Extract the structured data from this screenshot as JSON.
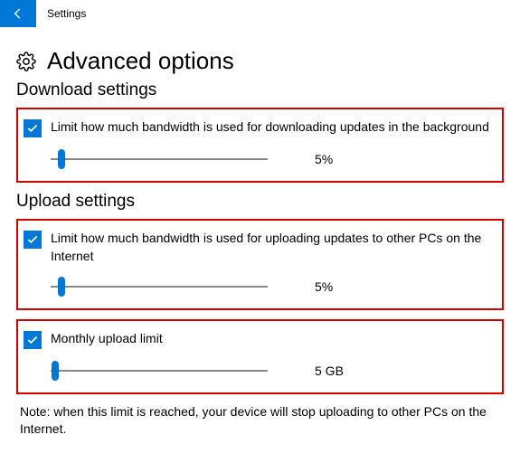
{
  "titlebar": {
    "app_title": "Settings"
  },
  "page": {
    "title": "Advanced options"
  },
  "download": {
    "heading": "Download settings",
    "limit_checkbox_label": "Limit how much bandwidth is used for downloading updates in the background",
    "limit_checked": true,
    "limit_value_label": "5%",
    "limit_slider_percent": 5
  },
  "upload": {
    "heading": "Upload settings",
    "limit_checkbox_label": "Limit how much bandwidth is used for uploading updates to other PCs on the Internet",
    "limit_checked": true,
    "limit_value_label": "5%",
    "limit_slider_percent": 5,
    "monthly_checkbox_label": "Monthly upload limit",
    "monthly_checked": true,
    "monthly_value_label": "5 GB",
    "monthly_slider_percent": 2
  },
  "note": "Note: when this limit is reached, your device will stop uploading to other PCs on the Internet."
}
